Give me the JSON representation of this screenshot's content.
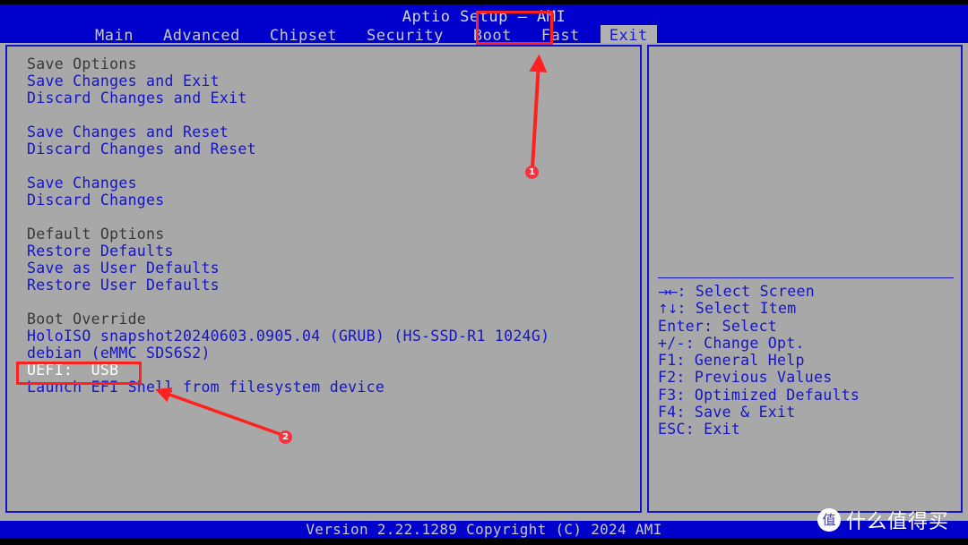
{
  "header": {
    "app_title": "Aptio Setup – AMI",
    "tabs": [
      {
        "label": "Main",
        "active": false
      },
      {
        "label": "Advanced",
        "active": false
      },
      {
        "label": "Chipset",
        "active": false
      },
      {
        "label": "Security",
        "active": false
      },
      {
        "label": "Boot",
        "active": false
      },
      {
        "label": "Fast",
        "active": false
      },
      {
        "label": "Exit",
        "active": true
      }
    ]
  },
  "main": {
    "options": [
      {
        "label": "Save Options",
        "type": "header"
      },
      {
        "label": "Save Changes and Exit",
        "type": "item"
      },
      {
        "label": "Discard Changes and Exit",
        "type": "item"
      },
      {
        "label": "",
        "type": "spacer"
      },
      {
        "label": "Save Changes and Reset",
        "type": "item"
      },
      {
        "label": "Discard Changes and Reset",
        "type": "item"
      },
      {
        "label": "",
        "type": "spacer"
      },
      {
        "label": "Save Changes",
        "type": "item"
      },
      {
        "label": "Discard Changes",
        "type": "item"
      },
      {
        "label": "",
        "type": "spacer"
      },
      {
        "label": "Default Options",
        "type": "header"
      },
      {
        "label": "Restore Defaults",
        "type": "item"
      },
      {
        "label": "Save as User Defaults",
        "type": "item"
      },
      {
        "label": "Restore User Defaults",
        "type": "item"
      },
      {
        "label": "",
        "type": "spacer"
      },
      {
        "label": "Boot Override",
        "type": "header"
      },
      {
        "label": "HoloISO snapshot20240603.0905.04 (GRUB) (HS-SSD-R1 1024G)",
        "type": "item"
      },
      {
        "label": "debian (eMMC SDS6S2)",
        "type": "item"
      },
      {
        "label": "UEFI:  USB",
        "type": "selected"
      },
      {
        "label": "Launch EFI Shell from filesystem device",
        "type": "item"
      }
    ]
  },
  "help": {
    "rows": [
      {
        "glyph": "→←",
        "text": ": Select Screen"
      },
      {
        "glyph": "↑↓",
        "text": ": Select Item"
      },
      {
        "glyph": "",
        "text": "Enter: Select"
      },
      {
        "glyph": "",
        "text": "+/-: Change Opt."
      },
      {
        "glyph": "",
        "text": "F1: General Help"
      },
      {
        "glyph": "",
        "text": "F2: Previous Values"
      },
      {
        "glyph": "",
        "text": "F3: Optimized Defaults"
      },
      {
        "glyph": "",
        "text": "F4: Save & Exit"
      },
      {
        "glyph": "",
        "text": "ESC: Exit"
      }
    ]
  },
  "footer": {
    "version_text": "Version 2.22.1289 Copyright (C) 2024 AMI"
  },
  "annotations": {
    "marker_1": "1",
    "marker_2": "2",
    "color": "#ff2020"
  },
  "watermark": {
    "logo_char": "值",
    "text": "什么值得买"
  }
}
